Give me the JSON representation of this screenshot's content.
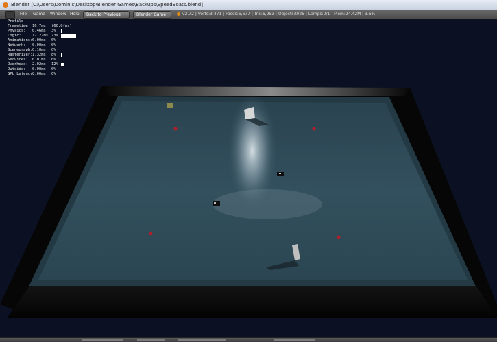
{
  "window": {
    "title": "Blender [C:\\Users\\Dominic\\Desktop\\Blender Games\\Backups\\SpeedBoats.blend]"
  },
  "menubar": {
    "file": "File",
    "game": "Game",
    "window": "Window",
    "help": "Help",
    "back_button": "Back to Previous",
    "engine_select": "Blender Game",
    "stats": "v2.72 | Verts:3,471 | Faces:6,677 | Tris:6,953 | Objects:0/25 | Lamps:0/1 | Mem:24.42M | 3.6%"
  },
  "profile": {
    "header": "Profile",
    "rows": [
      {
        "name": "Frametime:",
        "time": "16.7ms",
        "pct": "(60.0fps)",
        "level": 0
      },
      {
        "name": "Physics:",
        "time": "0.46ms",
        "pct": "3%",
        "level": 0.03
      },
      {
        "name": "Logic:",
        "time": "12.22ms",
        "pct": "73%",
        "level": 0.73
      },
      {
        "name": "Animations:",
        "time": "0.00ms",
        "pct": "0%",
        "level": 0
      },
      {
        "name": "Network:",
        "time": "0.00ms",
        "pct": "0%",
        "level": 0
      },
      {
        "name": "Scenegraph:",
        "time": "0.10ms",
        "pct": "0%",
        "level": 0
      },
      {
        "name": "Rasterizer:",
        "time": "1.32ms",
        "pct": "8%",
        "level": 0.08
      },
      {
        "name": "Services:",
        "time": "0.01ms",
        "pct": "0%",
        "level": 0
      },
      {
        "name": "Overhead:",
        "time": "2.02ms",
        "pct": "12%",
        "level": 0.12
      },
      {
        "name": "Outside:",
        "time": "0.00ms",
        "pct": "0%",
        "level": 0
      },
      {
        "name": "GPU Latency:",
        "time": "0.00ms",
        "pct": "0%",
        "level": 0
      }
    ]
  },
  "scene": {
    "description_colors": {
      "pool_rim": "#000000",
      "water": "#2f4a56",
      "buoy": "#b0202a"
    }
  }
}
